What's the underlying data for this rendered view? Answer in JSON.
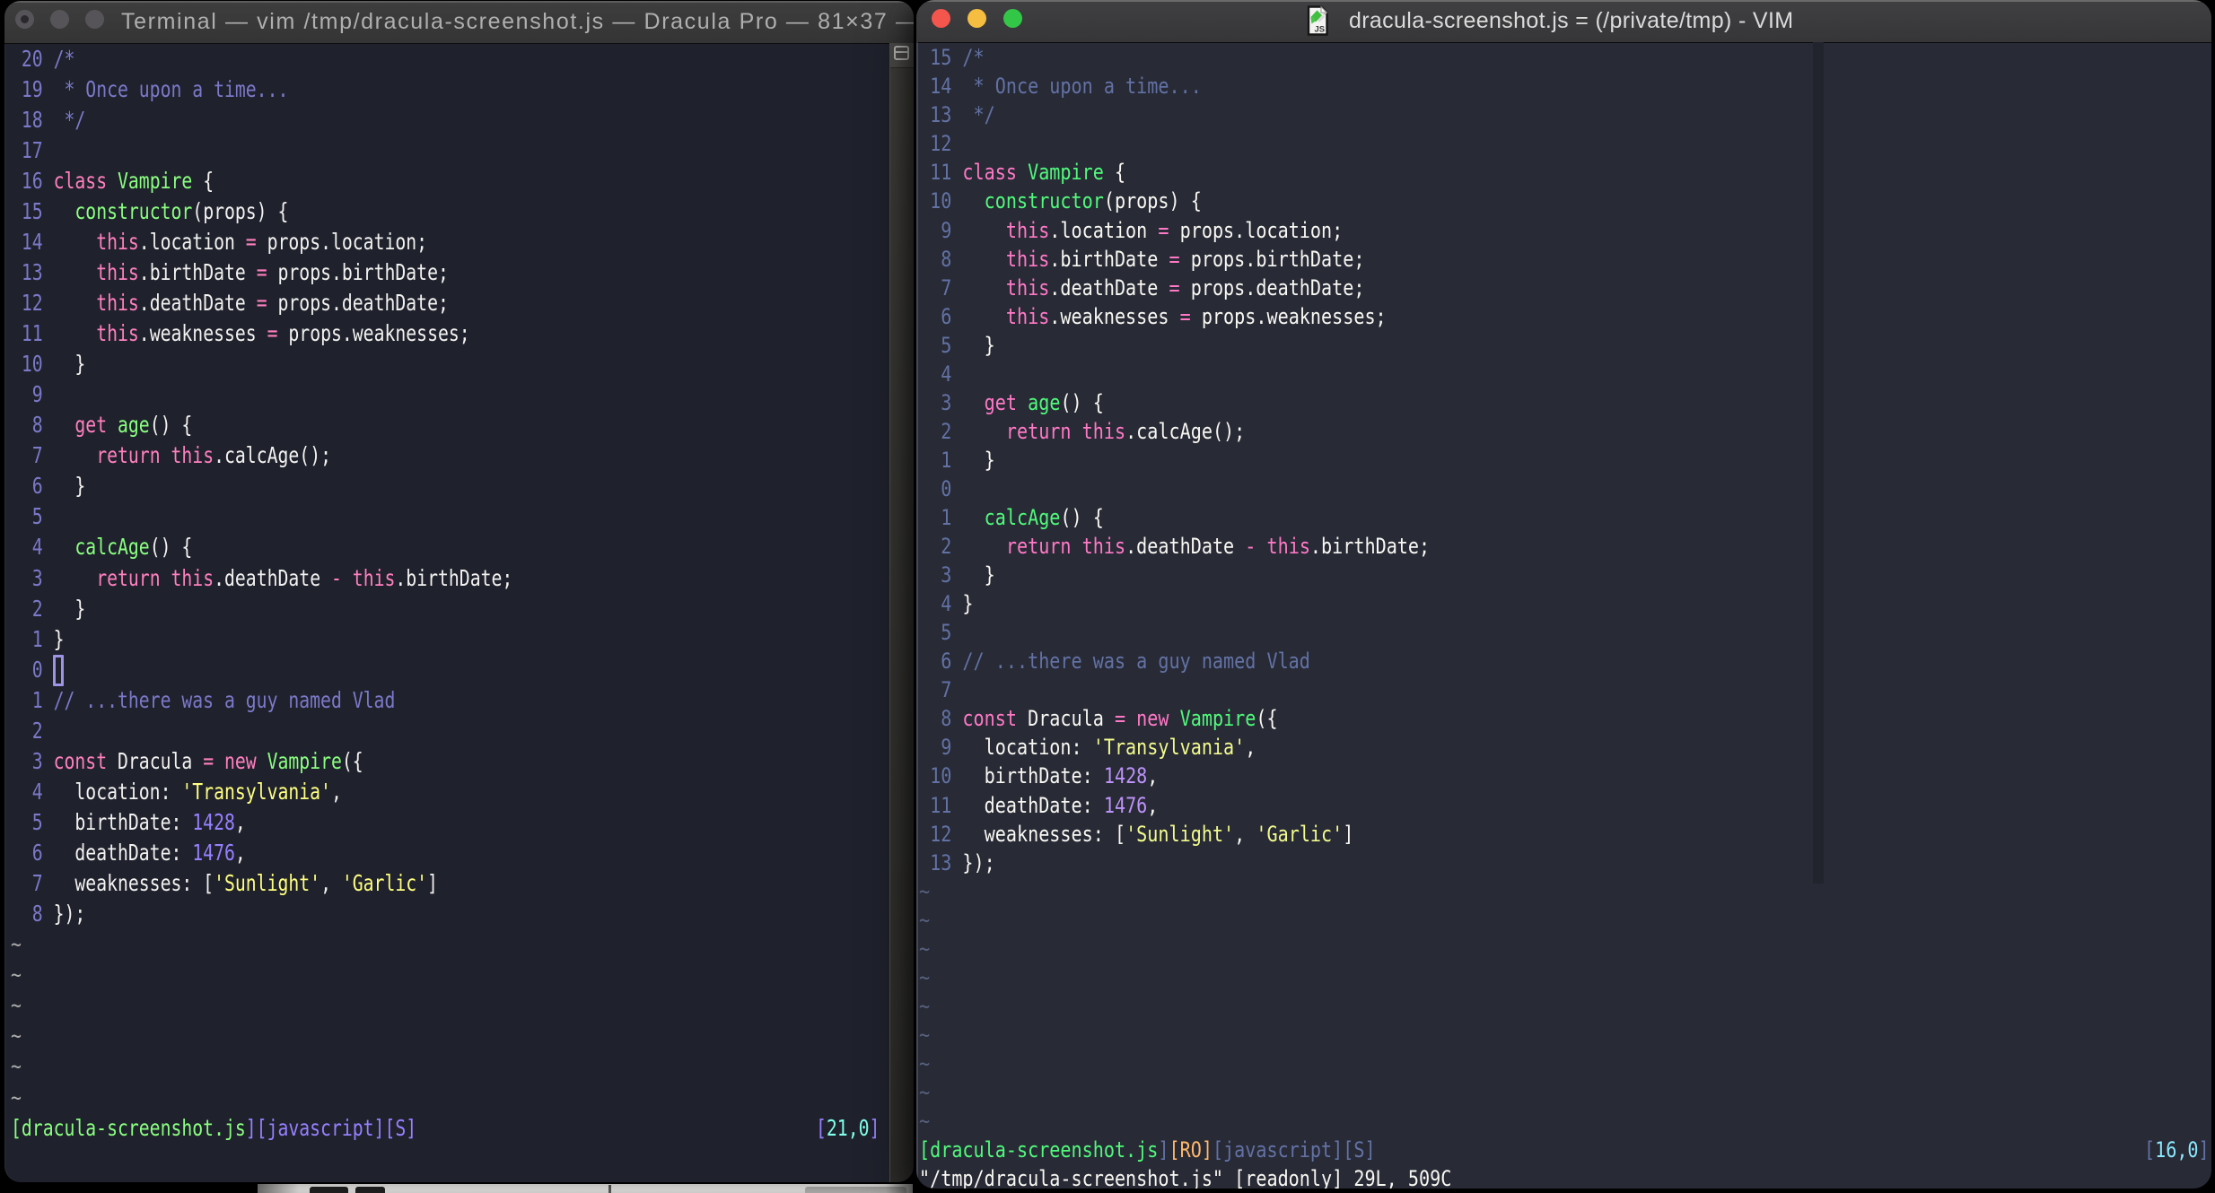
{
  "desktop": {
    "background_color": "#000000",
    "background_window_strip_color": "#CDCCCA"
  },
  "file_lines": [
    [
      [
        "/*",
        "m"
      ]
    ],
    [
      [
        " * Once upon a time...",
        "m"
      ]
    ],
    [
      [
        " */",
        "m"
      ]
    ],
    [],
    [
      [
        "class",
        "p"
      ],
      [
        " ",
        "f"
      ],
      [
        "Vampire",
        "g"
      ],
      [
        " {",
        "f"
      ]
    ],
    [
      [
        "  ",
        "f"
      ],
      [
        "constructor",
        "g"
      ],
      [
        "(props) {",
        "f"
      ]
    ],
    [
      [
        "    ",
        "f"
      ],
      [
        "this",
        "p"
      ],
      [
        ".location ",
        "f"
      ],
      [
        "=",
        "p"
      ],
      [
        " props.location;",
        "f"
      ]
    ],
    [
      [
        "    ",
        "f"
      ],
      [
        "this",
        "p"
      ],
      [
        ".birthDate ",
        "f"
      ],
      [
        "=",
        "p"
      ],
      [
        " props.birthDate;",
        "f"
      ]
    ],
    [
      [
        "    ",
        "f"
      ],
      [
        "this",
        "p"
      ],
      [
        ".deathDate ",
        "f"
      ],
      [
        "=",
        "p"
      ],
      [
        " props.deathDate;",
        "f"
      ]
    ],
    [
      [
        "    ",
        "f"
      ],
      [
        "this",
        "p"
      ],
      [
        ".weaknesses ",
        "f"
      ],
      [
        "=",
        "p"
      ],
      [
        " props.weaknesses;",
        "f"
      ]
    ],
    [
      [
        "  }",
        "f"
      ]
    ],
    [],
    [
      [
        "  ",
        "f"
      ],
      [
        "get",
        "p"
      ],
      [
        " ",
        "f"
      ],
      [
        "age",
        "g"
      ],
      [
        "() {",
        "f"
      ]
    ],
    [
      [
        "    ",
        "f"
      ],
      [
        "return",
        "p"
      ],
      [
        " ",
        "f"
      ],
      [
        "this",
        "p"
      ],
      [
        ".calcAge();",
        "f"
      ]
    ],
    [
      [
        "  }",
        "f"
      ]
    ],
    [],
    [
      [
        "  ",
        "f"
      ],
      [
        "calcAge",
        "g"
      ],
      [
        "() {",
        "f"
      ]
    ],
    [
      [
        "    ",
        "f"
      ],
      [
        "return",
        "p"
      ],
      [
        " ",
        "f"
      ],
      [
        "this",
        "p"
      ],
      [
        ".deathDate ",
        "f"
      ],
      [
        "-",
        "p"
      ],
      [
        " ",
        "f"
      ],
      [
        "this",
        "p"
      ],
      [
        ".birthDate;",
        "f"
      ]
    ],
    [
      [
        "  }",
        "f"
      ]
    ],
    [
      [
        "}",
        "f"
      ]
    ],
    [],
    [
      [
        "// ...there was a guy named Vlad",
        "m"
      ]
    ],
    [],
    [
      [
        "const",
        "p"
      ],
      [
        " Dracula ",
        "f"
      ],
      [
        "=",
        "p"
      ],
      [
        " ",
        "f"
      ],
      [
        "new",
        "p"
      ],
      [
        " ",
        "f"
      ],
      [
        "Vampire",
        "g"
      ],
      [
        "({",
        "f"
      ]
    ],
    [
      [
        "  location: ",
        "f"
      ],
      [
        "'Transylvania'",
        "y"
      ],
      [
        ",",
        "f"
      ]
    ],
    [
      [
        "  birthDate: ",
        "f"
      ],
      [
        "1428",
        "u"
      ],
      [
        ",",
        "f"
      ]
    ],
    [
      [
        "  deathDate: ",
        "f"
      ],
      [
        "1476",
        "u"
      ],
      [
        ",",
        "f"
      ]
    ],
    [
      [
        "  weaknesses: [",
        "f"
      ],
      [
        "'Sunlight'",
        "y"
      ],
      [
        ", ",
        "f"
      ],
      [
        "'Garlic'",
        "y"
      ],
      [
        "]",
        "f"
      ]
    ],
    [
      [
        "});",
        "f"
      ]
    ]
  ],
  "left_window": {
    "app": "Terminal",
    "title": "Terminal — vim /tmp/dracula-screenshot.js — Dracula Pro — 81×37 —…",
    "theme": "Dracula Pro",
    "rel_numbers": [
      "20",
      "19",
      "18",
      "17",
      "16",
      "15",
      "14",
      "13",
      "12",
      "11",
      "10",
      "9",
      "8",
      "7",
      "6",
      "5",
      "4",
      "3",
      "2",
      "1",
      "0",
      "1",
      "2",
      "3",
      "4",
      "5",
      "6",
      "7",
      "8"
    ],
    "tilde_count": 6,
    "cursor_position_label": "[21,0]",
    "status_left": [
      [
        "[dracula-screenshot.js",
        "g"
      ],
      [
        "][javascript][S]",
        "u"
      ]
    ],
    "status_right": [
      [
        "[",
        "u"
      ],
      [
        "21,0",
        "c"
      ],
      [
        "]",
        "u"
      ]
    ],
    "colors": {
      "background": "#1F212C",
      "foreground": "#F2F2F0",
      "comment": "#7B79C9",
      "pink": "#FF80BF",
      "green": "#8AFF80",
      "yellow": "#FFFF80",
      "purple": "#9580FF",
      "cyan": "#80FFEA",
      "tilde": "#ABABAB",
      "titlebar": "#3A3A3A",
      "title_text": "#AFAFAF"
    }
  },
  "right_window": {
    "app": "MacVim",
    "title": "dracula-screenshot.js = (/private/tmp) - VIM",
    "rel_numbers": [
      "15",
      "14",
      "13",
      "12",
      "11",
      "10",
      "9",
      "8",
      "7",
      "6",
      "5",
      "4",
      "3",
      "2",
      "1",
      "0",
      "1",
      "2",
      "3",
      "4",
      "5",
      "6",
      "7",
      "8",
      "9",
      "10",
      "11",
      "12",
      "13"
    ],
    "tilde_count": 9,
    "cursor_position_label": "[16,0]",
    "status_left": [
      [
        "[dracula-screenshot.js",
        "g"
      ],
      [
        "]",
        "m"
      ],
      [
        "[RO]",
        "o"
      ],
      [
        "[javascript][S]",
        "m"
      ]
    ],
    "status_right": [
      [
        "[",
        "m"
      ],
      [
        "16,0",
        "c"
      ],
      [
        "]",
        "m"
      ]
    ],
    "message": "\"/tmp/dracula-screenshot.js\" [readonly] 29L, 509C",
    "colors": {
      "background": "#282A36",
      "foreground": "#F8F8F2",
      "comment": "#6272A4",
      "pink": "#FF79C6",
      "green": "#50FA7B",
      "yellow": "#F1FA8C",
      "purple": "#BD93F9",
      "cyan": "#8BE9FD",
      "orange": "#FFB86C",
      "tilde": "#57607E",
      "titlebar": "#3C3C3E",
      "title_text": "#DBDBDC",
      "traffic_red": "#F4554D",
      "traffic_yellow": "#F6BE40",
      "traffic_green": "#33C748"
    }
  }
}
